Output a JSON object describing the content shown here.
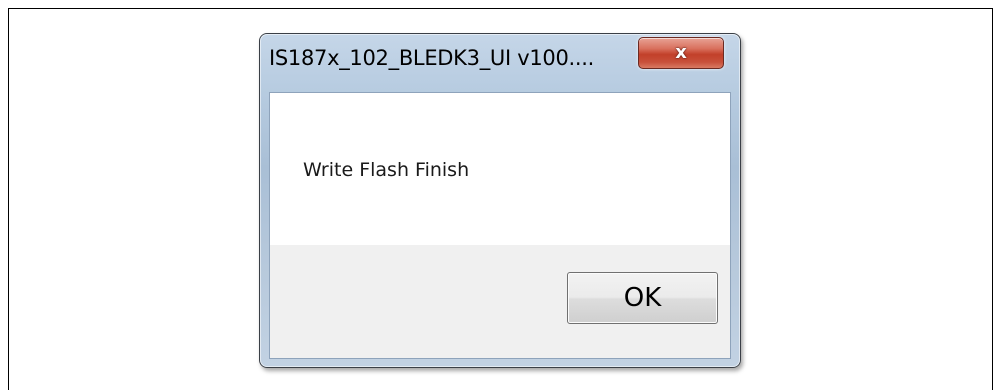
{
  "dialog": {
    "title": "IS187x_102_BLEDK3_UI v100....",
    "close_icon": "close-icon",
    "close_glyph": "x",
    "message": "Write Flash Finish",
    "ok_label": "OK"
  },
  "colors": {
    "close_button": "#c7442e",
    "frame_chrome": "#b6cbe0",
    "button_area": "#f0f0f0"
  }
}
